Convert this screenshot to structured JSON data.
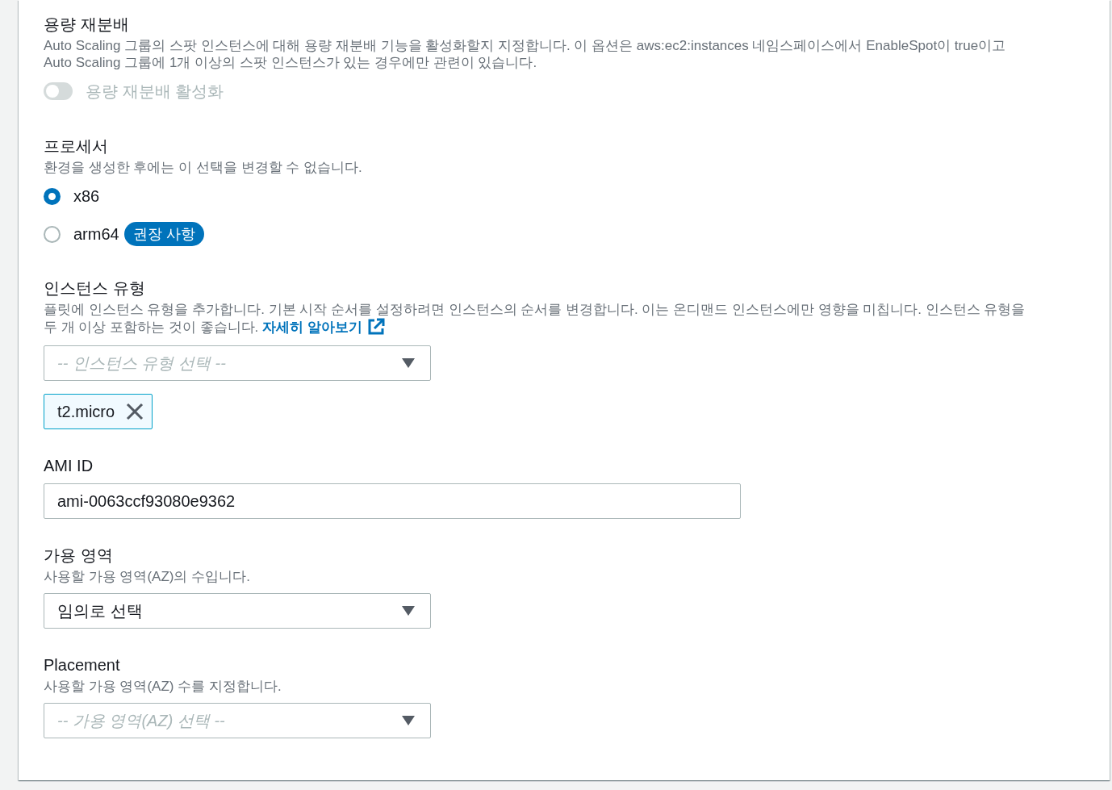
{
  "sections": [
    {
      "kind": "toggle",
      "title": "용량 재분배",
      "description": "Auto Scaling 그룹의 스팟 인스턴스에 대해 용량 재분배 기능을 활성화할지 지정합니다. 이 옵션은 aws:ec2:instances 네임스페이스에서 EnableSpot이 true이고 Auto Scaling 그룹에 1개 이상의 스팟 인스턴스가 있는 경우에만 관련이 있습니다.",
      "toggle": {
        "label": "용량 재분배 활성화",
        "on": false,
        "disabled": true
      }
    },
    {
      "kind": "radio",
      "title": "프로세서",
      "description": "환경을 생성한 후에는 이 선택을 변경할 수 없습니다.",
      "options": [
        {
          "label": "x86",
          "selected": true
        },
        {
          "label": "arm64",
          "selected": false,
          "badge": "권장 사항"
        }
      ]
    },
    {
      "kind": "multiselect",
      "title": "인스턴스 유형",
      "description": "플릿에 인스턴스 유형을 추가합니다. 기본 시작 순서를 설정하려면 인스턴스의 순서를 변경합니다. 이는 온디맨드 인스턴스에만 영향을 미칩니다. 인스턴스 유형을 두 개 이상 포함하는 것이 좋습니다.",
      "link": "자세히 알아보기",
      "placeholder": "-- 인스턴스 유형 선택 --",
      "tokens": [
        "t2.micro"
      ]
    },
    {
      "kind": "input",
      "title": "AMI ID",
      "value": "ami-0063ccf93080e9362"
    },
    {
      "kind": "select",
      "title": "가용 영역",
      "description": "사용할 가용 영역(AZ)의 수입니다.",
      "value": "임의로 선택"
    },
    {
      "kind": "select",
      "title": "Placement",
      "description": "사용할 가용 영역(AZ) 수를 지정합니다.",
      "placeholder": "-- 가용 영역(AZ) 선택 --"
    }
  ]
}
